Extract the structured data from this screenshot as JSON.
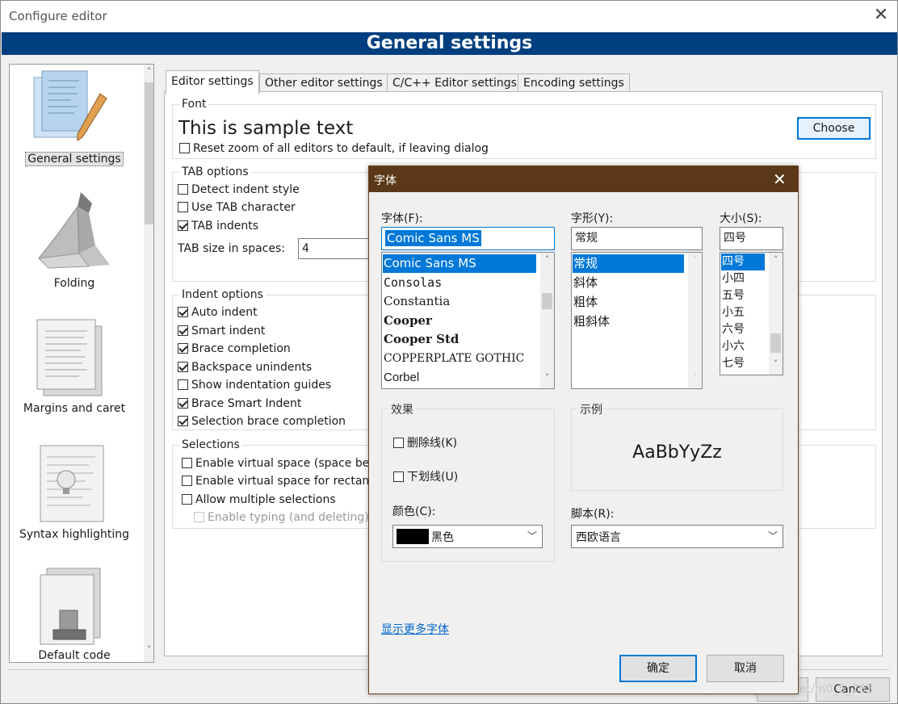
{
  "window": {
    "title": "Configure editor",
    "close_glyph": "✕"
  },
  "header": {
    "title": "General settings"
  },
  "sidebar": {
    "items": [
      {
        "label": "General settings",
        "icon": "general-settings-icon"
      },
      {
        "label": "Folding",
        "icon": "folding-icon"
      },
      {
        "label": "Margins and caret",
        "icon": "margins-icon"
      },
      {
        "label": "Syntax highlighting",
        "icon": "syntax-highlighting-icon"
      },
      {
        "label": "Default code",
        "icon": "default-code-icon"
      }
    ],
    "scroll_up": "˄",
    "scroll_down": "˅"
  },
  "tabs": [
    "Editor settings",
    "Other editor settings",
    "C/C++ Editor settings",
    "Encoding settings"
  ],
  "font_group": {
    "title": "Font",
    "sample": "This is sample text",
    "reset_zoom": "Reset zoom of all editors to default, if leaving dialog",
    "choose": "Choose"
  },
  "tab_group": {
    "title": "TAB options",
    "detect": "Detect indent style",
    "use_tab": "Use TAB character",
    "tab_indents": "TAB indents",
    "size_label": "TAB size in spaces:",
    "size_value": "4"
  },
  "indent_group": {
    "title": "Indent options",
    "items": [
      "Auto indent",
      "Smart indent",
      "Brace completion",
      "Backspace unindents",
      "Show indentation guides",
      "Brace Smart Indent",
      "Selection brace completion"
    ],
    "checked": [
      true,
      true,
      true,
      true,
      false,
      true,
      true
    ]
  },
  "selections_group": {
    "title": "Selections",
    "items": [
      "Enable virtual space (space bey",
      "Enable virtual space for rectang",
      "Allow multiple selections",
      "Enable typing (and deleting)"
    ]
  },
  "bottom": {
    "cancel": "Cancel"
  },
  "font_dialog": {
    "title": "字体",
    "close_glyph": "✕",
    "font_label": "字体(F):",
    "font_value": "Comic Sans MS",
    "fonts": [
      "Comic Sans MS",
      "Consolas",
      "Constantia",
      "Cooper",
      "Cooper Std",
      "COPPERPLATE GOTHIC",
      "Corbel"
    ],
    "style_label": "字形(Y):",
    "style_value": "常规",
    "styles": [
      "常规",
      "斜体",
      "粗体",
      "粗斜体"
    ],
    "size_label": "大小(S):",
    "size_value": "四号",
    "sizes": [
      "四号",
      "小四",
      "五号",
      "小五",
      "六号",
      "小六",
      "七号"
    ],
    "effects_title": "效果",
    "strikeout": "删除线(K)",
    "underline": "下划线(U)",
    "color_label": "颜色(C):",
    "color_value": "黑色",
    "color_swatch": "#000000",
    "sample_title": "示例",
    "sample_text": "AaBbYyZz",
    "script_label": "脚本(R):",
    "script_value": "西欧语言",
    "more_fonts": "显示更多字体",
    "ok": "确定",
    "cancel": "取消"
  },
  "watermark": "https://blog.csdn.net/m0_5_283",
  "colors": {
    "header_bg": "#003f7f",
    "dialog_title_bg": "#5a3818",
    "selection": "#0078d7"
  }
}
